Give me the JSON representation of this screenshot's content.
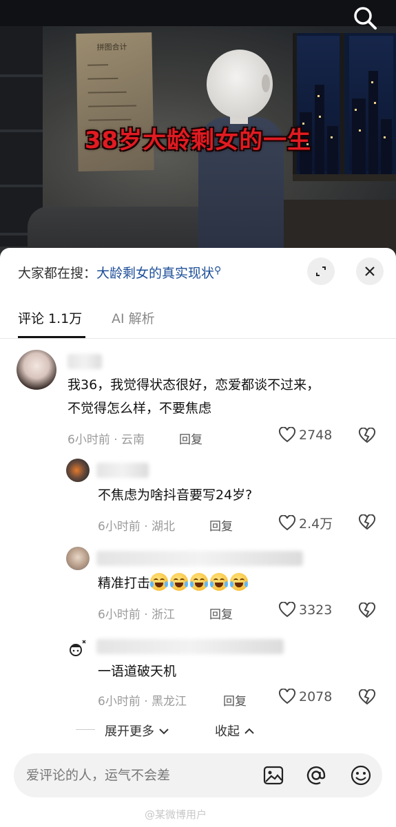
{
  "video": {
    "title": "38岁大龄剩女的一生",
    "poster_title": "拼图合计"
  },
  "header": {
    "trending_prefix": "大家都在搜：",
    "trending_query": "大龄剩女的真实现状"
  },
  "tabs": [
    {
      "label": "评论 1.1万"
    },
    {
      "label": "AI 解析"
    }
  ],
  "comments": [
    {
      "text_line1": "我36，我觉得状态很好，恋爱都谈不过来，",
      "text_line2": "不觉得怎么样，不要焦虑",
      "meta": "6小时前 · 云南",
      "reply": "回复",
      "likes": "2748"
    },
    {
      "text": "不焦虑为啥抖音要写24岁?",
      "meta": "6小时前 · 湖北",
      "reply": "回复",
      "likes": "2.4万"
    },
    {
      "text": "精准打击",
      "emoji_count": 5,
      "meta": "6小时前 · 浙江",
      "reply": "回复",
      "likes": "3323"
    },
    {
      "text": "一语道破天机",
      "meta": "6小时前 · 黑龙江",
      "reply": "回复",
      "likes": "2078"
    }
  ],
  "thread_controls": {
    "expand": "展开更多",
    "collapse": "收起"
  },
  "input": {
    "placeholder": "爱评论的人，运气不会差"
  },
  "watermark": "@某微博用户",
  "colors": {
    "title_red": "#e11b22",
    "link_blue": "#1b4d98"
  }
}
